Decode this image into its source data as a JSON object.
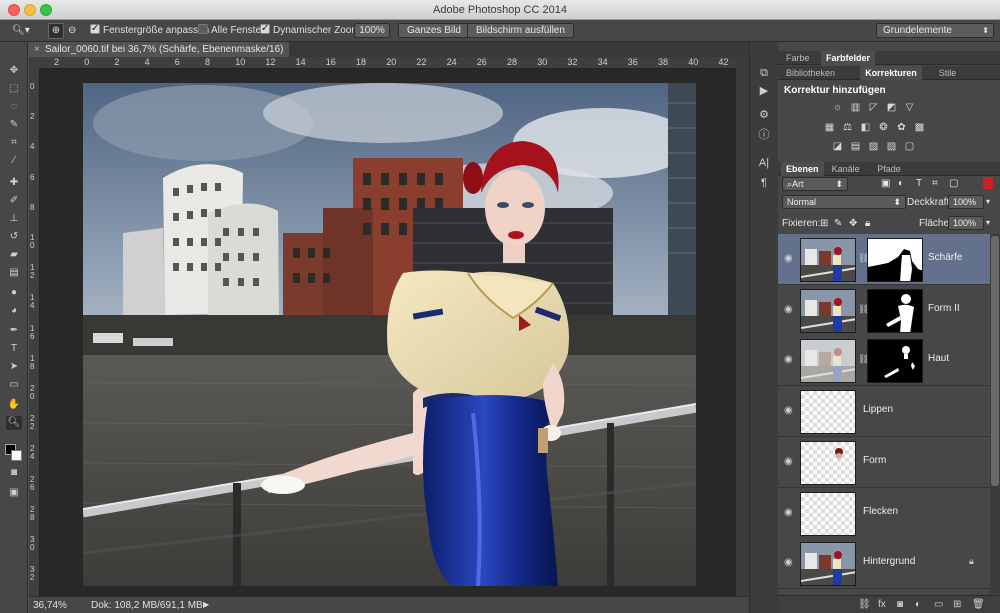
{
  "window": {
    "title": "Adobe Photoshop CC 2014"
  },
  "options_bar": {
    "resize_windows_label": "Fenstergröße anpassen",
    "resize_windows_checked": true,
    "all_windows_label": "Alle Fenster",
    "all_windows_checked": false,
    "scrubby_zoom_label": "Dynamischer Zoom",
    "scrubby_zoom_checked": true,
    "zoom_value": "100%",
    "fit_screen_label": "Ganzes Bild",
    "fill_screen_label": "Bildschirm ausfüllen",
    "workspace": "Grundelemente"
  },
  "document": {
    "tab_title": "Sailor_0060.tif bei 36,7% (Schärfe, Ebenenmaske/16) *",
    "close_glyph": "×"
  },
  "ruler": {
    "h_labels": [
      "2",
      "0",
      "2",
      "4",
      "6",
      "8",
      "10",
      "12",
      "14",
      "16",
      "18",
      "20",
      "22",
      "24",
      "26",
      "28",
      "30",
      "32",
      "34",
      "36",
      "38",
      "40",
      "42"
    ],
    "v_labels": [
      "0",
      "2",
      "4",
      "6",
      "8",
      "1 0",
      "1 2",
      "1 4",
      "1 6",
      "1 8",
      "2 0",
      "2 2",
      "2 4",
      "2 6",
      "2 8",
      "3 0",
      "3 2"
    ]
  },
  "status_bar": {
    "zoom": "36,74%",
    "doc_info": "Dok: 108,2 MB/691,1 MB"
  },
  "panels": {
    "top_tabs": [
      "Farbe",
      "Farbfelder"
    ],
    "top_active": 1,
    "mid_tabs": [
      "Bibliotheken",
      "Korrekturen",
      "Stile"
    ],
    "mid_active": 1,
    "adjustments_title": "Korrektur hinzufügen",
    "layer_tabs": [
      "Ebenen",
      "Kanäle",
      "Pfade"
    ],
    "layer_active": 0,
    "filter_kind": "Art",
    "blend_mode": "Normal",
    "opacity_label": "Deckkraft:",
    "opacity_value": "100%",
    "lock_label": "Fixieren:",
    "fill_label": "Fläche:",
    "fill_value": "100%"
  },
  "layers": [
    {
      "name": "Schärfe",
      "selected": true,
      "has_mask": true,
      "thumb": "photo",
      "mask": "schaerfe"
    },
    {
      "name": "Form II",
      "selected": false,
      "has_mask": true,
      "thumb": "photo",
      "mask": "figure"
    },
    {
      "name": "Haut",
      "selected": false,
      "has_mask": true,
      "thumb": "photo-light",
      "mask": "skin"
    },
    {
      "name": "Lippen",
      "selected": false,
      "has_mask": false,
      "thumb": "transparent"
    },
    {
      "name": "Form",
      "selected": false,
      "has_mask": false,
      "thumb": "transparent-dot"
    },
    {
      "name": "Flecken",
      "selected": false,
      "has_mask": false,
      "thumb": "transparent"
    },
    {
      "name": "Hintergrund",
      "selected": false,
      "has_mask": false,
      "thumb": "photo",
      "locked": true
    }
  ],
  "colors": {
    "selection": "#64718d",
    "panel_bg": "#474747",
    "canvas_bg": "#282828"
  }
}
